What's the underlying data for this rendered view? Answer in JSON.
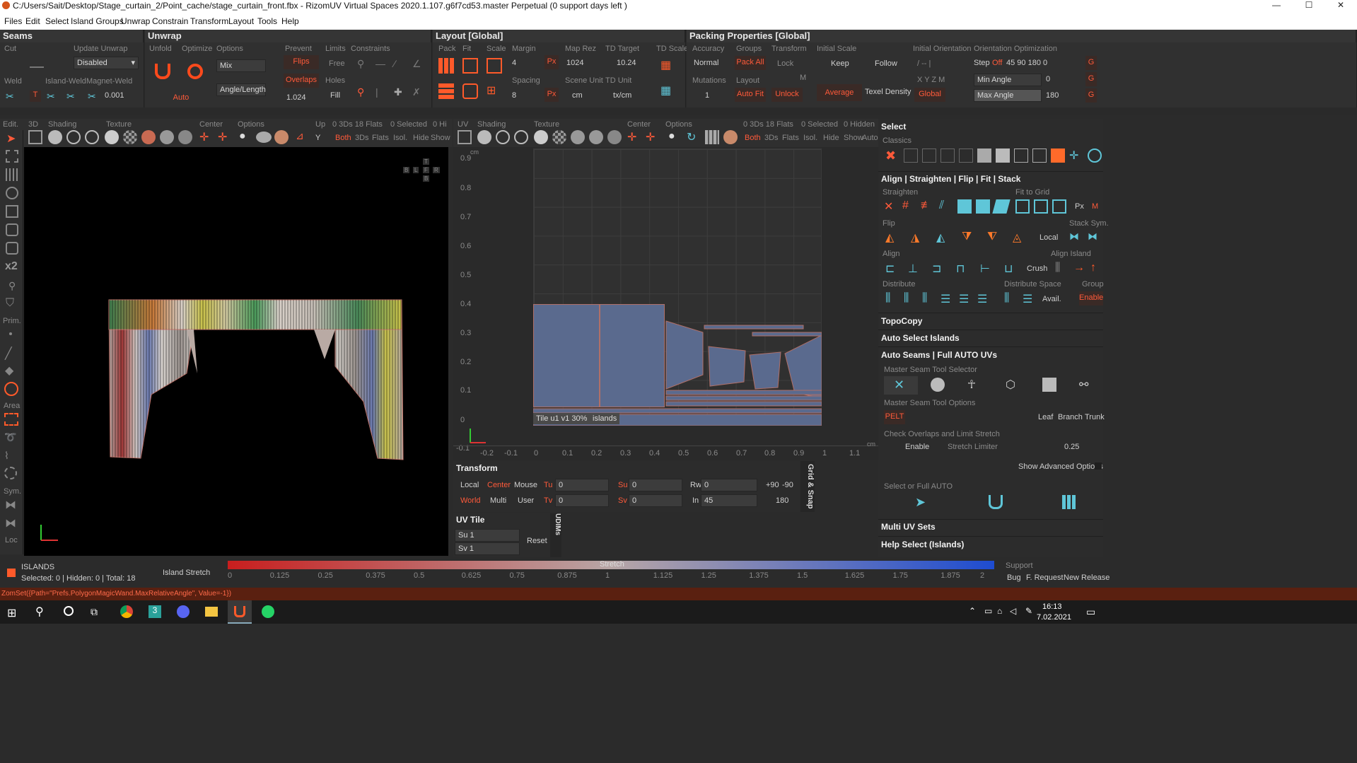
{
  "title_bar": {
    "title": "C:/Users/Sait/Desktop/Stage_curtain_2/Point_cache/stage_curtain_front.fbx - RizomUV  Virtual Spaces 2020.1.107.g6f7cd53.master Perpetual  (0 support days left )",
    "minimize": "—",
    "maximize": "☐",
    "close": "✕"
  },
  "menu": [
    "Files",
    "Edit",
    "Select",
    "Island Groups",
    "Unwrap",
    "Constrain",
    "Transform",
    "Layout",
    "Tools",
    "Help"
  ],
  "seams": {
    "title": "Seams",
    "cut": "Cut",
    "update_unwrap": "Update Unwrap",
    "disabled": "Disabled",
    "weld": "Weld",
    "island_weld": "Island-Weld",
    "magnet_weld": "Magnet-Weld",
    "magnet_value": "0.001",
    "t": "T"
  },
  "unwrap": {
    "title": "Unwrap",
    "unfold": "Unfold",
    "optimize": "Optimize",
    "options": "Options",
    "mix": "Mix",
    "angle_length": "Angle/Length",
    "auto": "Auto",
    "prevent": "Prevent",
    "flips": "Flips",
    "overlaps": "Overlaps",
    "overlaps_value": "1.024",
    "limits": "Limits",
    "free": "Free",
    "holes": "Holes",
    "fill": "Fill",
    "constraints": "Constraints"
  },
  "layout": {
    "title": "Layout [Global]",
    "pack": "Pack",
    "fit": "Fit",
    "scale": "Scale",
    "margin": "Margin",
    "margin_value": "4",
    "px": "Px",
    "spacing": "Spacing",
    "spacing_value": "8",
    "map_rez": "Map Rez",
    "map_rez_value": "1024",
    "scene_unit": "Scene Unit",
    "scene_unit_value": "cm",
    "td_target": "TD Target",
    "td_target_value": "10.24",
    "td_unit": "TD Unit",
    "td_unit_value": "tx/cm",
    "td_scale": "TD Scale"
  },
  "packing": {
    "title": "Packing Properties [Global]",
    "accuracy": "Accuracy",
    "accuracy_value": "Normal",
    "mutations": "Mutations",
    "mutations_value": "1",
    "groups": "Groups",
    "pack_all": "Pack All",
    "layout": "Layout",
    "auto_fit": "Auto Fit",
    "transform": "Transform",
    "lock": "Lock",
    "unlock": "Unlock",
    "m": "M",
    "initial_scale": "Initial Scale",
    "keep": "Keep",
    "follow": "Follow",
    "average": "Average",
    "texel_density": "Texel Density",
    "initial_orientation": "Initial Orientation",
    "io_top": "/  --  |",
    "io_xyz": "X  Y  Z  M",
    "global": "Global",
    "orientation_optimization": "Orientation Optimization",
    "step": "Step",
    "off": "Off",
    "step_values": "45  90  180  0",
    "min_angle": "Min Angle",
    "min_angle_value": "0",
    "max_angle": "Max Angle",
    "max_angle_value": "180",
    "g": "G"
  },
  "view3d": {
    "edit": "Edit.",
    "tab": "3D",
    "shading": "Shading",
    "texture": "Texture",
    "center": "Center",
    "options": "Options",
    "up": "Up",
    "up_value": "Y",
    "counts": "0 3Ds 18 Flats",
    "selected": "0 Selected",
    "hidden": "0 Hi",
    "both": "Both",
    "threeds": "3Ds",
    "flats": "Flats",
    "isol": "Isol.",
    "hide": "Hide",
    "show": "Show",
    "cube": {
      "t": "T",
      "b": "B",
      "l": "L",
      "f": "F",
      "r": "R",
      "b2": "B"
    }
  },
  "viewuv": {
    "tab": "UV",
    "shading": "Shading",
    "texture": "Texture",
    "center": "Center",
    "options": "Options",
    "counts": "0 3Ds 18 Flats",
    "selected": "0 Selected",
    "hidden": "0 Hidden",
    "both": "Both",
    "threeds": "3Ds",
    "flats": "Flats",
    "isol": "Isol.",
    "hide": "Hide",
    "show": "Show",
    "auto": "Auto",
    "cm": "cm",
    "tile_label": "Tile u1 v1 30%",
    "islands": "islands",
    "y_ticks": [
      "0.9",
      "0.8",
      "0.7",
      "0.6",
      "0.5",
      "0.4",
      "0.3",
      "0.2",
      "0.1",
      "0",
      "-0.1"
    ],
    "x_ticks": [
      "-0.1",
      "-0.2",
      "-0.1",
      "0",
      "0.1",
      "0.2",
      "0.3",
      "0.4",
      "0.5",
      "0.6",
      "0.7",
      "0.8",
      "0.9",
      "1",
      "1.1"
    ]
  },
  "left_tools": [
    "Prim.",
    "Area",
    "Sym.",
    "Loc"
  ],
  "transform": {
    "title": "Transform",
    "local": "Local",
    "center": "Center",
    "mouse": "Mouse",
    "world": "World",
    "multi": "Multi",
    "user": "User",
    "tu": "Tu",
    "tu_value": "0",
    "tv": "Tv",
    "tv_value": "0",
    "su": "Su",
    "su_value": "0",
    "sv": "Sv",
    "sv_value": "0",
    "rw": "Rw",
    "rw_value": "0",
    "in": "In",
    "in_value": "45",
    "plus90": "+90",
    "minus90": "-90",
    "r180": "180",
    "grid_snap": "Grid & Snap"
  },
  "uv_tile": {
    "title": "UV Tile",
    "su": "Su 1",
    "sv": "Sv 1",
    "reset": "Reset",
    "udims": "UDIMs"
  },
  "select_panel": {
    "title": "Select",
    "classics": "Classics",
    "align_title": "Align | Straighten | Flip | Fit | Stack",
    "straighten": "Straighten",
    "fit_to_grid": "Fit to Grid",
    "px": "Px",
    "m": "M",
    "flip": "Flip",
    "stack_sym": "Stack Sym.",
    "local": "Local",
    "align": "Align",
    "align_island": "Align Island",
    "crush": "Crush",
    "distribute": "Distribute",
    "distribute_space": "Distribute Space",
    "group": "Group",
    "avail": "Avail.",
    "enable": "Enable",
    "topocopy": "TopoCopy",
    "auto_select": "Auto Select Islands",
    "auto_seams": "Auto Seams | Full AUTO UVs",
    "master_seam_selector": "Master Seam Tool Selector",
    "master_seam_options": "Master Seam Tool Options",
    "pelt": "PELT",
    "leaf": "Leaf",
    "branch": "Branch",
    "trunk": "Trunk",
    "check_overlaps": "Check Overlaps and Limit Stretch",
    "enable2": "Enable",
    "stretch_limiter": "Stretch Limiter",
    "stretch_value": "0.25",
    "show_advanced": "Show Advanced Options",
    "select_or_full": "Select or Full AUTO",
    "multi_uv": "Multi UV Sets",
    "help_select": "Help Select (Islands)"
  },
  "status": {
    "islands": "ISLANDS",
    "counts": "Selected: 0 | Hidden: 0 | Total: 18",
    "island_stretch": "Island Stretch",
    "stretch": "Stretch",
    "ticks": [
      "0",
      "0.125",
      "0.25",
      "0.375",
      "0.5",
      "0.625",
      "0.75",
      "0.875",
      "1",
      "1.125",
      "1.25",
      "1.375",
      "1.5",
      "1.625",
      "1.75",
      "1.875",
      "2"
    ],
    "support": "Support",
    "bug": "Bug",
    "f_request": "F. Request",
    "new_release": "New Release"
  },
  "error_line": "ZomSet({Path=\"Prefs.PolygonMagicWand.MaxRelativeAngle\", Value=-1})",
  "taskbar": {
    "time": "16:13",
    "date": "7.02.2021"
  },
  "colors": {
    "accent_red": "#ff5a3a",
    "uv_island": "#5a6a8e",
    "panel": "#303030"
  }
}
